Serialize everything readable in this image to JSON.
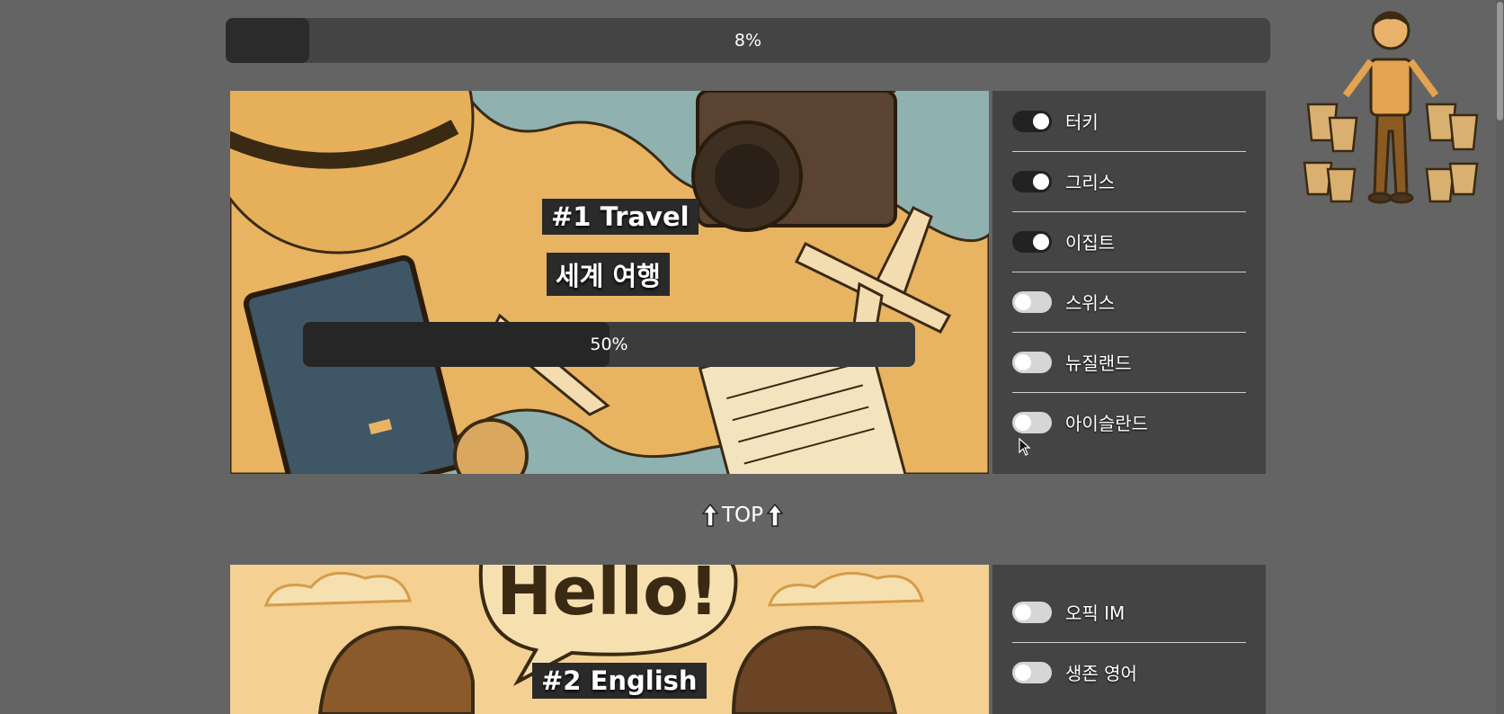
{
  "overall_progress": {
    "percent": 8,
    "label": "8%"
  },
  "top_link": {
    "label": "TOP"
  },
  "cards": [
    {
      "title": "#1 Travel",
      "subtitle": "세계 여행",
      "progress": {
        "percent": 50,
        "label": "50%"
      },
      "items": [
        {
          "label": "터키",
          "checked": true
        },
        {
          "label": "그리스",
          "checked": true
        },
        {
          "label": "이집트",
          "checked": true
        },
        {
          "label": "스위스",
          "checked": false
        },
        {
          "label": "뉴질랜드",
          "checked": false
        },
        {
          "label": "아이슬란드",
          "checked": false
        }
      ]
    },
    {
      "title": "#2 English",
      "speech_bubble": "Hello!",
      "items": [
        {
          "label": "오픽 IM",
          "checked": false
        },
        {
          "label": "생존 영어",
          "checked": false
        }
      ]
    }
  ],
  "colors": {
    "page_bg": "#646464",
    "panel_bg": "#444444",
    "toggle_on": "#222222",
    "toggle_off": "#d6d6d6",
    "travel_bg": "#e8b462",
    "english_bg": "#f4d192"
  }
}
